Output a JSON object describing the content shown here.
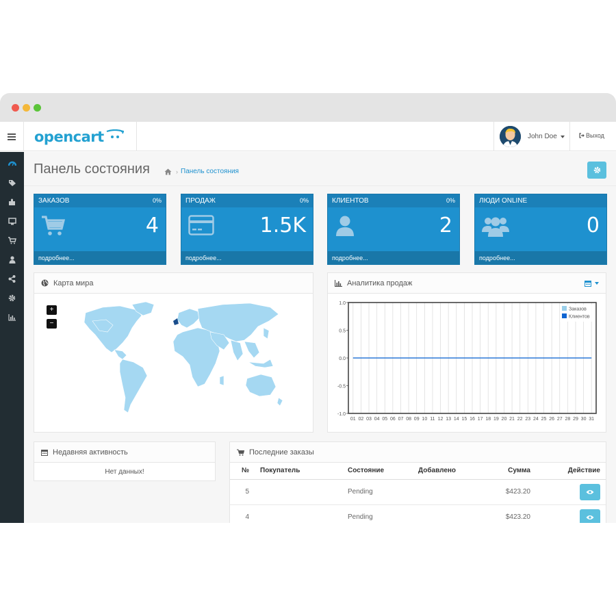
{
  "header": {
    "logo_text": "opencart",
    "user_name": "John Doe",
    "logout_label": "Выход"
  },
  "sidebar": {
    "items": [
      {
        "icon": "dashboard-icon"
      },
      {
        "icon": "tags-icon"
      },
      {
        "icon": "puzzle-icon"
      },
      {
        "icon": "desktop-icon"
      },
      {
        "icon": "cart-icon"
      },
      {
        "icon": "user-icon"
      },
      {
        "icon": "share-icon"
      },
      {
        "icon": "cog-icon"
      },
      {
        "icon": "bar-chart-icon"
      }
    ]
  },
  "page": {
    "title": "Панель состояния",
    "breadcrumb": "Панель состояния"
  },
  "tiles": [
    {
      "label": "ЗАКАЗОВ",
      "percent": "0%",
      "value": "4",
      "more": "подробнее..."
    },
    {
      "label": "ПРОДАЖ",
      "percent": "0%",
      "value": "1.5K",
      "more": "подробнее..."
    },
    {
      "label": "КЛИЕНТОВ",
      "percent": "0%",
      "value": "2",
      "more": "подробнее..."
    },
    {
      "label": "ЛЮДИ ONLINE",
      "percent": "",
      "value": "0",
      "more": "подробнее..."
    }
  ],
  "map_panel": {
    "title": "Карта мира",
    "zoom_in": "+",
    "zoom_out": "−"
  },
  "analytics_panel": {
    "title": "Аналитика продаж"
  },
  "chart_data": {
    "type": "line",
    "x": [
      "01",
      "02",
      "03",
      "04",
      "05",
      "06",
      "07",
      "08",
      "09",
      "10",
      "11",
      "12",
      "13",
      "14",
      "15",
      "16",
      "17",
      "18",
      "19",
      "20",
      "21",
      "22",
      "23",
      "24",
      "25",
      "26",
      "27",
      "28",
      "29",
      "30",
      "31"
    ],
    "ylim": [
      -1.0,
      1.0
    ],
    "yticks": [
      "1.0",
      "0.5",
      "0.0",
      "-0.5",
      "-1.0"
    ],
    "grid": true,
    "legend_position": "top-right",
    "series": [
      {
        "name": "Заказов",
        "color": "#9acfea",
        "values": [
          0,
          0,
          0,
          0,
          0,
          0,
          0,
          0,
          0,
          0,
          0,
          0,
          0,
          0,
          0,
          0,
          0,
          0,
          0,
          0,
          0,
          0,
          0,
          0,
          0,
          0,
          0,
          0,
          0,
          0,
          0
        ]
      },
      {
        "name": "Клиентов",
        "color": "#1065d2",
        "values": [
          0,
          0,
          0,
          0,
          0,
          0,
          0,
          0,
          0,
          0,
          0,
          0,
          0,
          0,
          0,
          0,
          0,
          0,
          0,
          0,
          0,
          0,
          0,
          0,
          0,
          0,
          0,
          0,
          0,
          0,
          0
        ]
      }
    ]
  },
  "activity_panel": {
    "title": "Недавняя активность",
    "empty": "Нет данных!"
  },
  "orders_panel": {
    "title": "Последние заказы",
    "columns": [
      "№",
      "Покупатель",
      "Состояние",
      "Добавлено",
      "Сумма",
      "Действие"
    ],
    "rows": [
      {
        "id": "5",
        "customer": "",
        "status": "Pending",
        "date": "",
        "total": "$423.20"
      },
      {
        "id": "4",
        "customer": "",
        "status": "Pending",
        "date": "",
        "total": "$423.20"
      }
    ]
  },
  "colors": {
    "brand": "#1e91cf",
    "sidebar": "#222d33",
    "info": "#5bc0de"
  }
}
